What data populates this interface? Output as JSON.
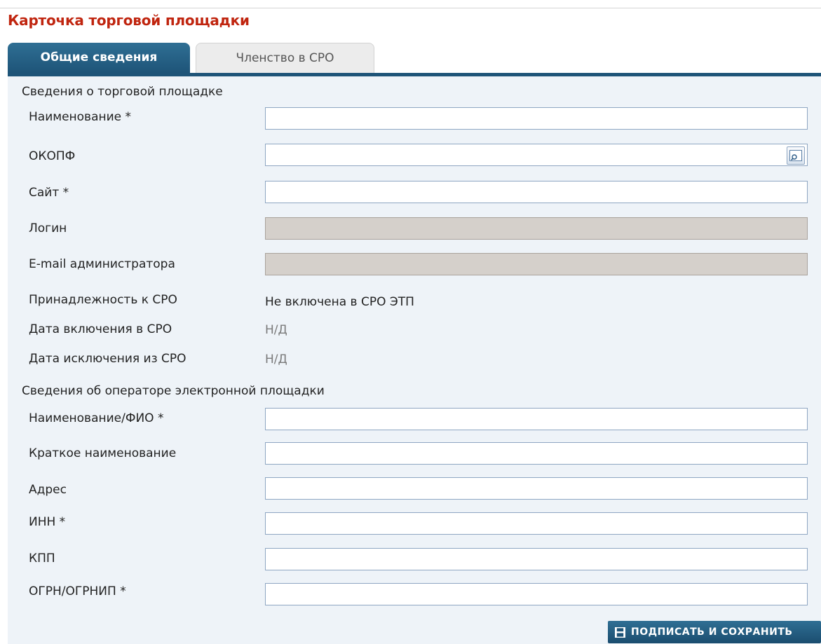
{
  "page": {
    "title": "Карточка торговой площадки"
  },
  "tabs": [
    {
      "label": "Общие сведения",
      "active": true
    },
    {
      "label": "Членство в СРО",
      "active": false
    }
  ],
  "platform_section": {
    "title": "Сведения о торговой площадке",
    "fields": {
      "name": {
        "label": "Наименование *",
        "value": ""
      },
      "okopf": {
        "label": "ОКОПФ",
        "value": "",
        "lookup_icon": "lookup-icon"
      },
      "site": {
        "label": "Сайт *",
        "value": ""
      },
      "login": {
        "label": "Логин",
        "value": "",
        "readonly": true
      },
      "admin_email": {
        "label": "E-mail администратора",
        "value": "",
        "readonly": true
      }
    },
    "info": {
      "sro_membership": {
        "label": "Принадлежность к СРО",
        "value": "Не включена в СРО ЭТП"
      },
      "sro_inclusion_date": {
        "label": "Дата включения в СРО",
        "value": "Н/Д"
      },
      "sro_exclusion_date": {
        "label": "Дата исключения из СРО",
        "value": "Н/Д"
      }
    }
  },
  "operator_section": {
    "title": "Сведения об операторе электронной площадки",
    "fields": {
      "full_name": {
        "label": "Наименование/ФИО *",
        "value": ""
      },
      "short_name": {
        "label": "Краткое наименование",
        "value": ""
      },
      "address": {
        "label": "Адрес",
        "value": ""
      },
      "inn": {
        "label": "ИНН *",
        "value": ""
      },
      "kpp": {
        "label": "КПП",
        "value": ""
      },
      "ogrn": {
        "label": "ОГРН/ОГРНИП *",
        "value": ""
      }
    }
  },
  "actions": {
    "sign_and_save_label": "ПОДПИСАТЬ И СОХРАНИТЬ",
    "sign_and_save_icon": "floppy-disk-icon"
  },
  "colors": {
    "title": "#c0250f",
    "tab_active": "#1e5478",
    "panel_background": "#eef3f8",
    "readonly_field": "#d5d0cb",
    "muted_value": "#7a7a7a"
  }
}
